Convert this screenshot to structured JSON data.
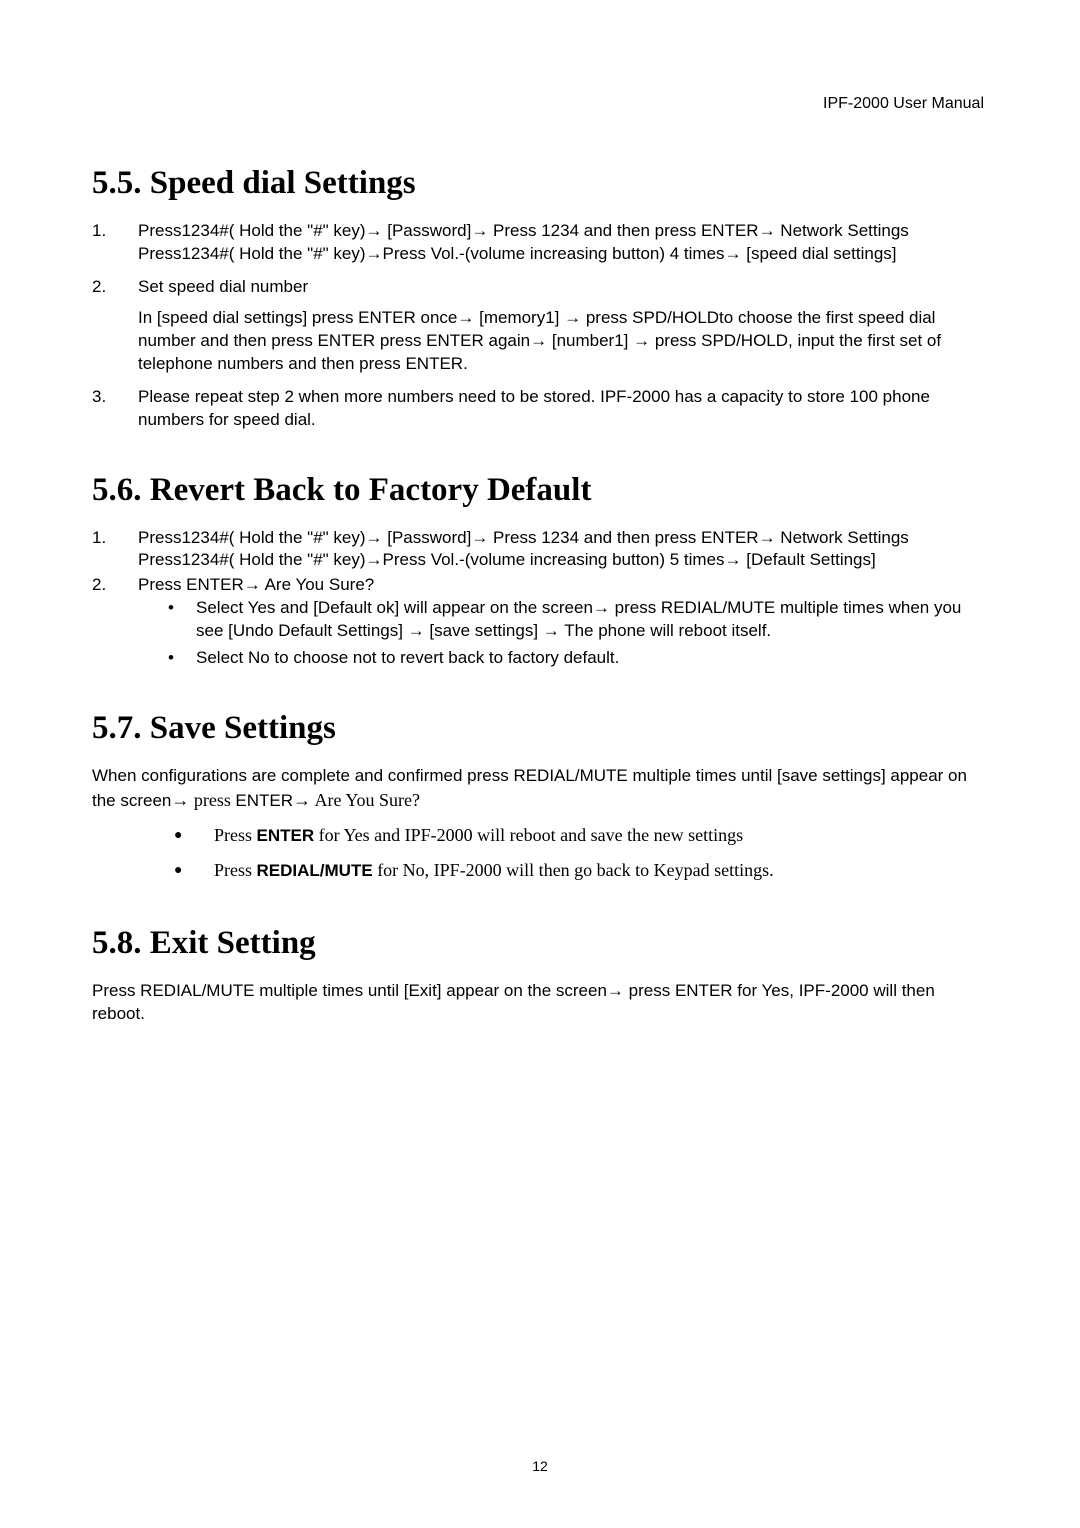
{
  "header": "IPF-2000 User Manual",
  "page_number": "12",
  "s55": {
    "title": "5.5.    Speed dial Settings",
    "li1": "Press1234#( Hold the \"#\" key)→ [Password]→ Press 1234 and then press ENTER→ Network Settings Press1234#( Hold the \"#\" key)→Press Vol.-(volume increasing button) 4 times→ [speed dial settings]",
    "li2": "Set speed dial number",
    "li2_sub": "In [speed dial settings] press ENTER once→ [memory1] → press SPD/HOLDto choose the first speed dial number and then press ENTER press ENTER again→ [number1] → press SPD/HOLD, input the first set of telephone numbers and then press ENTER.",
    "li3": "Please repeat step 2 when more numbers need to be stored.    IPF-2000 has a capacity to store 100 phone numbers for speed dial."
  },
  "s56": {
    "title": "5.6.    Revert Back to Factory Default",
    "li1": "Press1234#( Hold the \"#\" key)→ [Password]→ Press 1234 and then press ENTER→ Network Settings Press1234#( Hold the \"#\" key)→Press Vol.-(volume increasing button) 5 times→ [Default Settings]",
    "li2": "Press ENTER→ Are You Sure?",
    "b1": "Select Yes and [Default ok] will appear on the screen→ press REDIAL/MUTE multiple times when you see [Undo Default Settings] → [save settings] → The phone will reboot itself.",
    "b2": "Select No to choose not to revert back to factory default."
  },
  "s57": {
    "title": "5.7.    Save Settings",
    "para_a": "When configurations are complete and confirmed press REDIAL/MUTE multiple times until [save settings] appear on the screen",
    "para_b": "→ press ",
    "para_c": "ENTER",
    "para_d": "→ Are You Sure?",
    "b1_a": "Press ",
    "b1_b": "ENTER",
    "b1_c": " for Yes and IPF-2000 will reboot and save the new settings",
    "b2_a": "Press ",
    "b2_b": "REDIAL/MUTE",
    "b2_c": " for No, IPF-2000 will then go back to Keypad settings."
  },
  "s58": {
    "title": "5.8.    Exit Setting",
    "para": "Press REDIAL/MUTE multiple times until [Exit] appear on the screen→ press ENTER for Yes, IPF-2000 will then reboot."
  }
}
